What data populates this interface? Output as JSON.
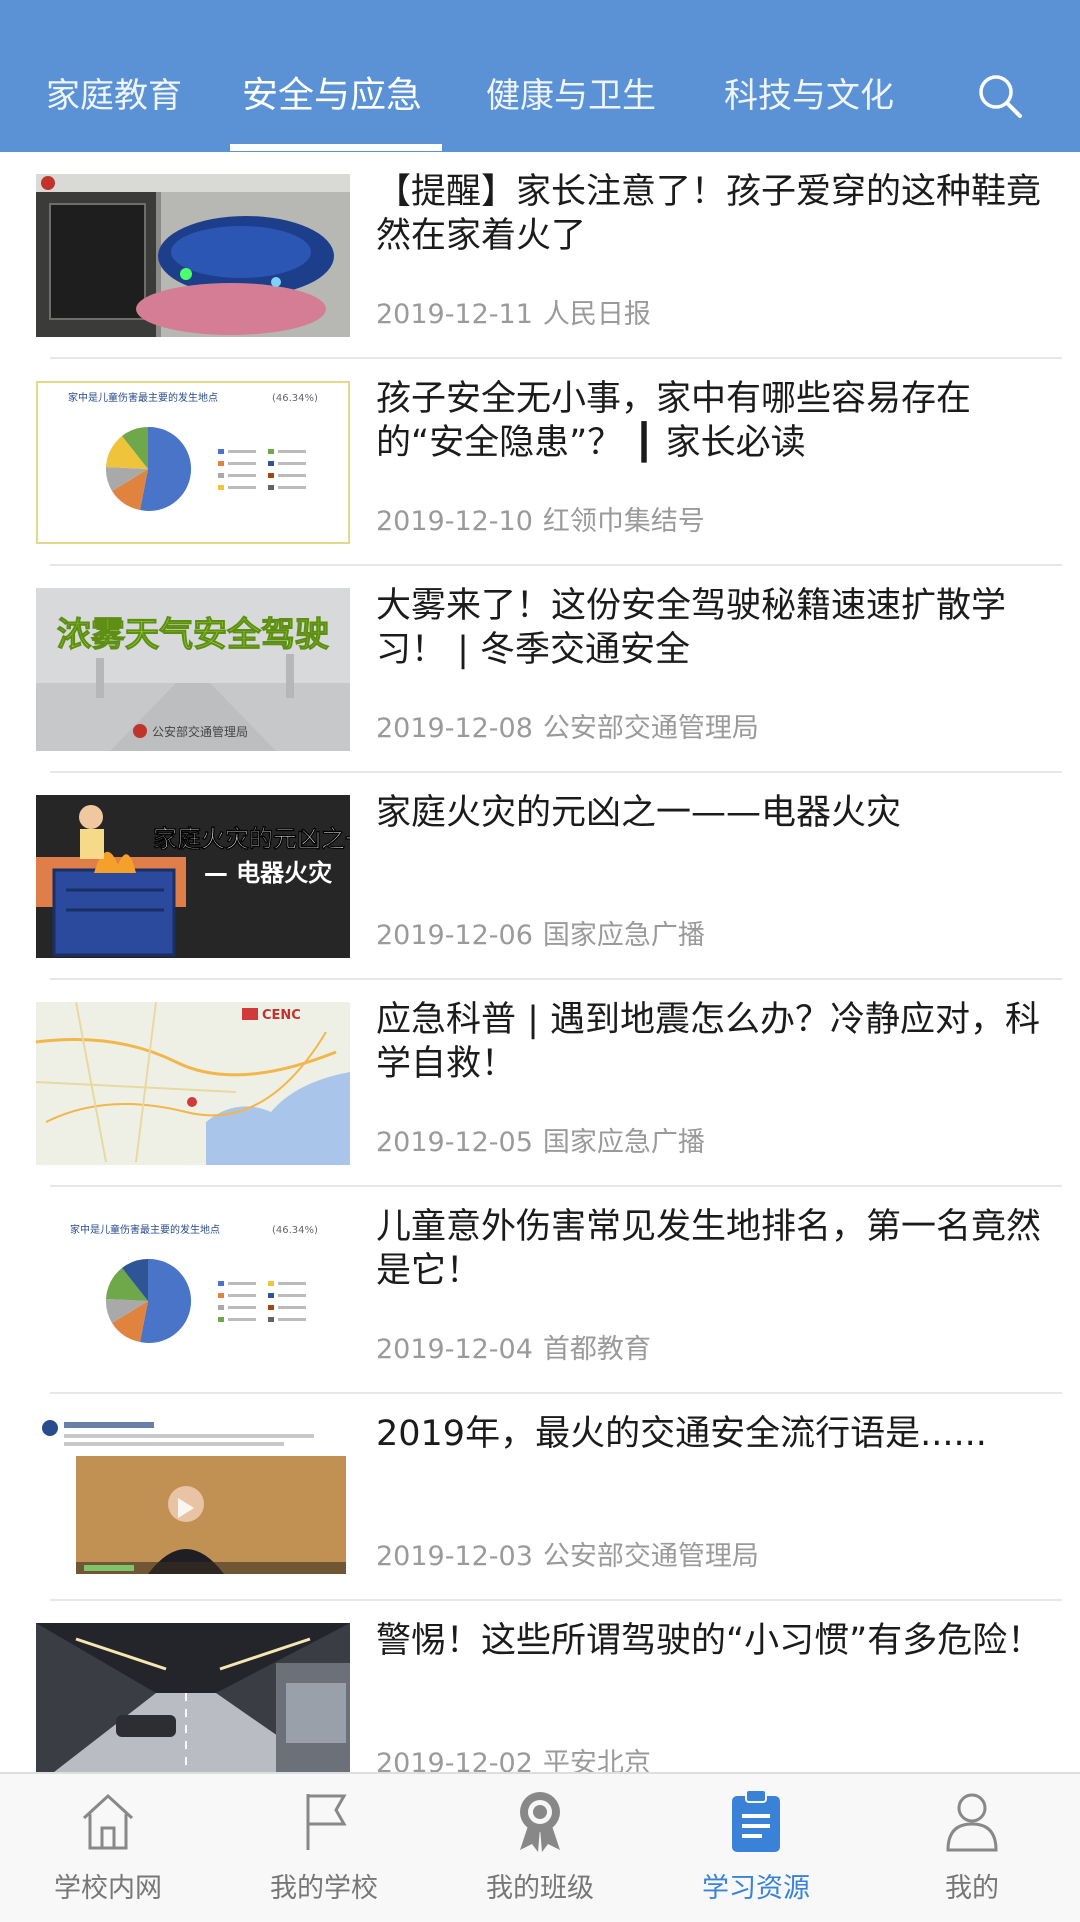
{
  "colors": {
    "header_bg": "#5b92d6",
    "accent": "#3a82d8",
    "title_text": "#1b1b1b",
    "meta_text": "#9a9a9a",
    "tabbar_bg": "#f8f8f8"
  },
  "top_tabs": [
    {
      "label": "家庭教育",
      "active": false
    },
    {
      "label": "安全与应急",
      "active": true
    },
    {
      "label": "健康与卫生",
      "active": false
    },
    {
      "label": "科技与文化",
      "active": false
    }
  ],
  "search_icon": "search-icon",
  "articles": [
    {
      "title": "【提醒】家长注意了！孩子爱穿的这种鞋竟然在家着火了",
      "date": "2019-12-11",
      "source": "人民日报",
      "thumb": "shoe-fire-photo"
    },
    {
      "title": "孩子安全无小事，家中有哪些容易存在的“安全隐患”？ ┃ 家长必读",
      "date": "2019-12-10",
      "source": "红领巾集结号",
      "thumb": "pie-chart-slide",
      "thumb_text": "家中是儿童伤害最主要的发生地点",
      "thumb_pct": "(46.34%)"
    },
    {
      "title": "大雾来了！这份安全驾驶秘籍速速扩散学习！ | 冬季交通安全",
      "date": "2019-12-08",
      "source": "公安部交通管理局",
      "thumb": "fog-driving-banner",
      "thumb_text": "浓雾天气安全驾驶",
      "thumb_sub": "公安部交通管理局"
    },
    {
      "title": "家庭火灾的元凶之一——电器火灾",
      "date": "2019-12-06",
      "source": "国家应急广播",
      "thumb": "appliance-fire-banner",
      "thumb_text": "家庭火灾的元凶之一",
      "thumb_sub": "— 电器火灾"
    },
    {
      "title": "应急科普 | 遇到地震怎么办？冷静应对，科学自救！",
      "date": "2019-12-05",
      "source": "国家应急广播",
      "thumb": "earthquake-map",
      "thumb_text": "CENC"
    },
    {
      "title": "儿童意外伤害常见发生地排名，第一名竟然是它！",
      "date": "2019-12-04",
      "source": "首都教育",
      "thumb": "pie-chart-slide",
      "thumb_text": "家中是儿童伤害最主要的发生地点",
      "thumb_pct": "(46.34%)"
    },
    {
      "title": "2019年，最火的交通安全流行语是......",
      "date": "2019-12-03",
      "source": "公安部交通管理局",
      "thumb": "video-presenter"
    },
    {
      "title": "警惕！这些所谓驾驶的“小习惯”有多危险！",
      "date": "2019-12-02",
      "source": "平安北京",
      "thumb": "tunnel-car-photo"
    }
  ],
  "bottom_tabs": [
    {
      "label": "学校内网",
      "icon": "home-icon",
      "active": false
    },
    {
      "label": "我的学校",
      "icon": "flag-icon",
      "active": false
    },
    {
      "label": "我的班级",
      "icon": "award-ribbon-icon",
      "active": false
    },
    {
      "label": "学习资源",
      "icon": "clipboard-icon",
      "active": true
    },
    {
      "label": "我的",
      "icon": "user-icon",
      "active": false
    }
  ]
}
